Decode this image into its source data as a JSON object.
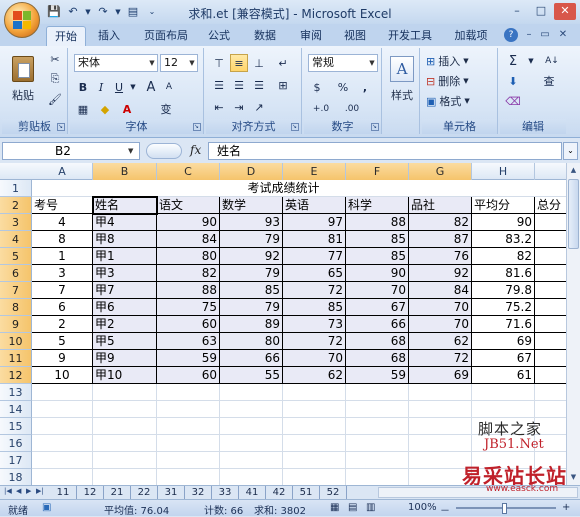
{
  "title_bar": {
    "title": "求和.et  [兼容模式] - Microsoft Excel",
    "minimize": "–",
    "maximize": "□",
    "close": "✕"
  },
  "ribbon_tabs": [
    "开始",
    "插入",
    "页面布局",
    "公式",
    "数据",
    "审阅",
    "视图",
    "开发工具",
    "加载项"
  ],
  "active_tab": "开始",
  "ribbon": {
    "clipboard": {
      "label": "剪贴板",
      "paste": "粘贴"
    },
    "font": {
      "label": "字体",
      "font_name": "宋体",
      "font_size": "12",
      "bold": "B",
      "italic": "I",
      "underline": "U",
      "grow": "A",
      "shrink": "A",
      "phonetic": "变"
    },
    "alignment": {
      "label": "对齐方式"
    },
    "number": {
      "label": "数字",
      "format": "常规",
      "currency": "$",
      "percent": "%",
      "comma": ",",
      "inc_decimal": "+.0",
      "dec_decimal": ".00"
    },
    "styles": {
      "label": "样式"
    },
    "cells": {
      "label": "单元格",
      "insert": "插入",
      "delete": "删除",
      "format": "格式"
    },
    "editing": {
      "label": "编辑",
      "sum": "Σ",
      "sort": "A↓",
      "find": "查"
    }
  },
  "formula_bar": {
    "name_box": "B2",
    "fx": "fx",
    "content": "姓名"
  },
  "columns": [
    "A",
    "B",
    "C",
    "D",
    "E",
    "F",
    "G",
    "H"
  ],
  "rows": [
    "1",
    "2",
    "3",
    "4",
    "5",
    "6",
    "7",
    "8",
    "9",
    "10",
    "11",
    "12",
    "13",
    "14",
    "15",
    "16",
    "17",
    "18"
  ],
  "sheet": {
    "title": "考试成绩统计",
    "headers": [
      "考号",
      "姓名",
      "语文",
      "数学",
      "英语",
      "科学",
      "品社",
      "平均分",
      "总分"
    ],
    "records": [
      [
        "4",
        "甲4",
        "90",
        "93",
        "97",
        "88",
        "82",
        "90"
      ],
      [
        "8",
        "甲8",
        "84",
        "79",
        "81",
        "85",
        "87",
        "83.2"
      ],
      [
        "1",
        "甲1",
        "80",
        "92",
        "77",
        "85",
        "76",
        "82"
      ],
      [
        "3",
        "甲3",
        "82",
        "79",
        "65",
        "90",
        "92",
        "81.6"
      ],
      [
        "7",
        "甲7",
        "88",
        "85",
        "72",
        "70",
        "84",
        "79.8"
      ],
      [
        "6",
        "甲6",
        "75",
        "79",
        "85",
        "67",
        "70",
        "75.2"
      ],
      [
        "2",
        "甲2",
        "60",
        "89",
        "73",
        "66",
        "70",
        "71.6"
      ],
      [
        "5",
        "甲5",
        "63",
        "80",
        "72",
        "68",
        "62",
        "69"
      ],
      [
        "9",
        "甲9",
        "59",
        "66",
        "70",
        "68",
        "72",
        "67"
      ],
      [
        "10",
        "甲10",
        "60",
        "55",
        "62",
        "59",
        "69",
        "61"
      ]
    ]
  },
  "sheet_tabs": [
    "11",
    "12",
    "21",
    "22",
    "31",
    "32",
    "33",
    "41",
    "42",
    "51",
    "52"
  ],
  "status_bar": {
    "ready": "就绪",
    "average": "平均值: 76.04",
    "count": "计数: 66",
    "sum": "求和: 3802",
    "zoom": "100%",
    "zoom_minus": "－",
    "zoom_plus": "+"
  },
  "watermarks": {
    "jb51_a": "脚本之家",
    "jb51_b": "JB51.Net",
    "easck_a": "易采站长站",
    "easck_b": "www.easck.com"
  },
  "colors": {
    "ribbon_bg": "#dbe6f4",
    "selection_shade": "#e9eaf6",
    "header_highlight": "#f5c46b",
    "watermark_red": "#c0212a"
  }
}
